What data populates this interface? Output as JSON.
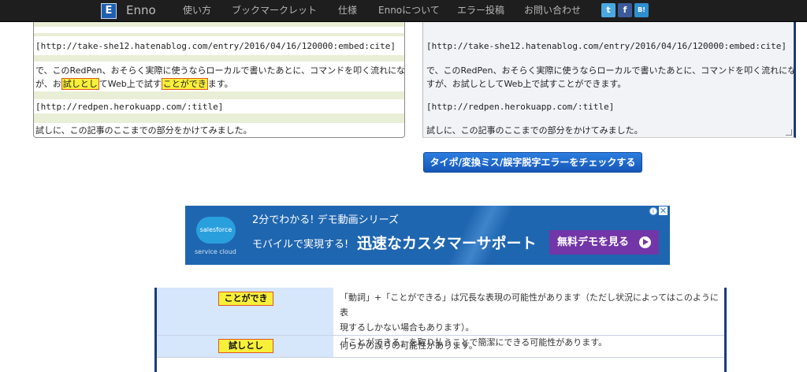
{
  "navbar": {
    "logo_letter": "E",
    "brand": "Enno",
    "items": [
      "使い方",
      "ブックマークレット",
      "仕様",
      "Ennoについて",
      "エラー投稿",
      "お問い合わせ"
    ],
    "share": {
      "twitter": "t",
      "facebook": "f",
      "hatena": "B!"
    }
  },
  "left_pane": {
    "lines": [
      {
        "text": "[http://take-she12.hatenablog.com/entry/2016/04/16/120000:embed:cite]"
      },
      {
        "text": "で、このRedPen、おそらく実際に使うならローカルで書いたあとに、コマンドを叩く流れになると思います"
      },
      {
        "pre": "が、お",
        "hl1": "試しとし",
        "mid": "てWeb上で試す",
        "hl2": "ことができ",
        "post": "ます。"
      },
      {
        "text": "[http://redpen.herokuapp.com/:title]"
      },
      {
        "text": "試しに、この記事のここまでの部分をかけてみました。"
      }
    ]
  },
  "right_pane": {
    "lines": [
      "[http://take-she12.hatenablog.com/entry/2016/04/16/120000:embed:cite]",
      "で、このRedPen、おそらく実際に使うならローカルで書いたあとに、コマンドを叩く流れになると思いま",
      "すが、お試しとしてWeb上で試すことができます。",
      "[http://redpen.herokuapp.com/:title]",
      "試しに、この記事のここまでの部分をかけてみました。"
    ]
  },
  "check_button": "タイポ/変換ミス/誤字脱字エラーをチェックする",
  "ad": {
    "logo": "salesforce",
    "logo_sub": "service cloud",
    "line1": "2分でわかる! デモ動画シリーズ",
    "line2a": "モバイルで実現する!",
    "line2b": "迅速なカスタマーサポート",
    "cta": "無料デモを見る",
    "info": "i",
    "close": "✕"
  },
  "results": [
    {
      "word": "ことができ",
      "messages": [
        "「動詞」+「ことができる」は冗長な表現の可能性があります（ただし状況によってはこのように表",
        "現するしかない場合もあります）。",
        "「ことができる」を取り払うことで簡潔にできる可能性があります。"
      ]
    },
    {
      "word": "試しとし",
      "messages": [
        "何らかの誤りの可能性があります。"
      ]
    }
  ],
  "colors": {
    "navbar_bg": "#1e1e1e",
    "highlight": "#f7ef3a",
    "highlight_border": "#e0561f",
    "button_blue": "#1f6fd0",
    "ad_blue": "#1f66b0",
    "ad_cta": "#7236a8",
    "result_word_bg": "#d6e6fb"
  }
}
